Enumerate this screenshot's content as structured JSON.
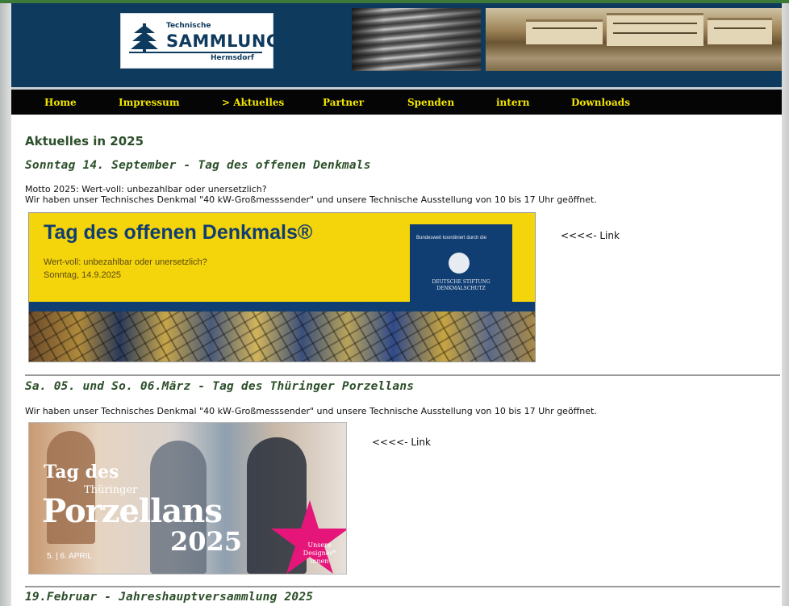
{
  "header": {
    "logo": {
      "line1": "Technische",
      "line2": "SAMMLUNG",
      "line3": "Hermsdorf"
    }
  },
  "nav": {
    "items": [
      {
        "label": "Home"
      },
      {
        "label": "Impressum"
      },
      {
        "label": "> Aktuelles"
      },
      {
        "label": "Partner"
      },
      {
        "label": "Spenden"
      },
      {
        "label": "intern"
      },
      {
        "label": "Downloads"
      }
    ],
    "colors": {
      "text": "#f2e600",
      "background": "#050505"
    }
  },
  "content": {
    "main_heading": "Aktuelles in 2025",
    "sections": [
      {
        "heading": "Sonntag 14. September - Tag des offenen Denkmals",
        "lines": [
          "Motto 2025: Wert-voll: unbezahlbar oder unersetzlich?",
          "Wir haben unser Technisches Denkmal \"40 kW-Großmesssender\" und unsere Technische Ausstellung von 10 bis 17 Uhr geöffnet."
        ],
        "banner": {
          "title": "Tag des offenen Denkmals®",
          "subtitle1": "Wert-voll: unbezahlbar oder unersetzlich?",
          "subtitle2": "Sonntag, 14.9.2025",
          "box_text1": "Bundesweit koordiniert durch die",
          "box_text2": "DEUTSCHE STIFTUNG DENKMALSCHUTZ"
        },
        "link": "<<<<- Link"
      },
      {
        "heading": "Sa. 05. und So. 06.März - Tag des Thüringer Porzellans",
        "lines": [
          "Wir haben unser Technisches Denkmal \"40 kW-Großmesssender\" und unsere Technische Ausstellung von 10 bis 17 Uhr geöffnet."
        ],
        "banner": {
          "text1": "Tag des",
          "text2": "Thüringer",
          "text3": "Porzellans",
          "text4": "2025",
          "date": "5. | 6. APRIL",
          "star_text": "Unsere Designer* innen"
        },
        "link": "<<<<- Link"
      },
      {
        "heading": "19.Februar - Jahreshauptversammlung 2025"
      }
    ],
    "colors": {
      "heading": "#2c4f2a",
      "header_bg": "#0e3a5e"
    }
  }
}
